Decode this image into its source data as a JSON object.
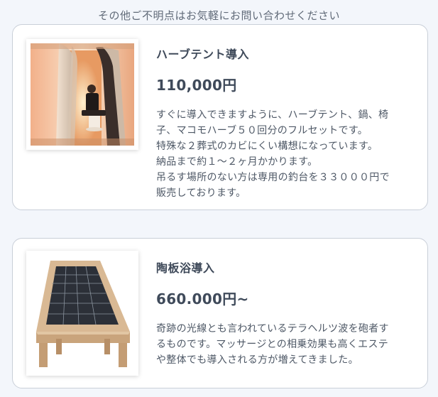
{
  "header": {
    "note": "その他ご不明点はお気軽にお問い合わせください"
  },
  "products": [
    {
      "title": "ハーブテント導入",
      "price": "110,000円",
      "description": "すぐに導入できますように、ハーブテント、鍋、椅\n子、マコモハーブ５０回分のフルセットです。\n特殊な２葬式のカビにくい構想になっています。\n納品まで約１～２ヶ月かかります。\n吊るす場所のない方は専用の釣台を３３０００円で\n販売しております。",
      "image": "herb-tent-photo"
    },
    {
      "title": "陶板浴導入",
      "price": "660.000円~",
      "description": "奇跡の光線とも言われているテラヘルツ波を砲者す\nるものです。マッサージとの相乗効果も高くエステ\nや整体でも導入される方が増えてきました。",
      "image": "ceramic-bed-photo"
    }
  ]
}
